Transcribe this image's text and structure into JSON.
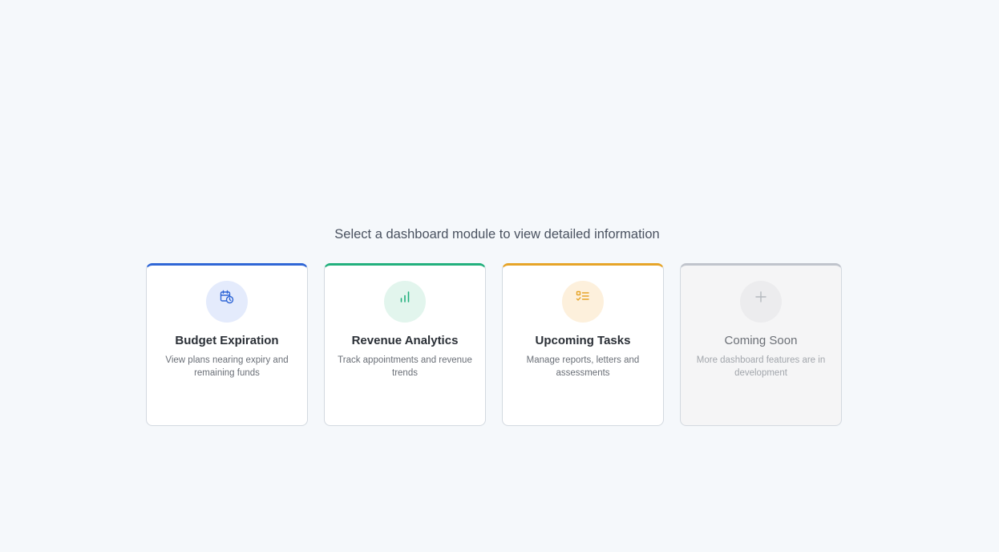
{
  "prompt": "Select a dashboard module to view detailed information",
  "cards": [
    {
      "title": "Budget Expiration",
      "description": "View plans nearing expiry and remaining funds",
      "icon": "calendar-clock-icon",
      "accent": "#2f66d6"
    },
    {
      "title": "Revenue Analytics",
      "description": "Track appointments and revenue trends",
      "icon": "bar-chart-icon",
      "accent": "#22b07d"
    },
    {
      "title": "Upcoming Tasks",
      "description": "Manage reports, letters and assessments",
      "icon": "task-list-icon",
      "accent": "#e6a428"
    },
    {
      "title": "Coming Soon",
      "description": "More dashboard features are in development",
      "icon": "plus-icon",
      "accent": "#c0c4cc"
    }
  ]
}
